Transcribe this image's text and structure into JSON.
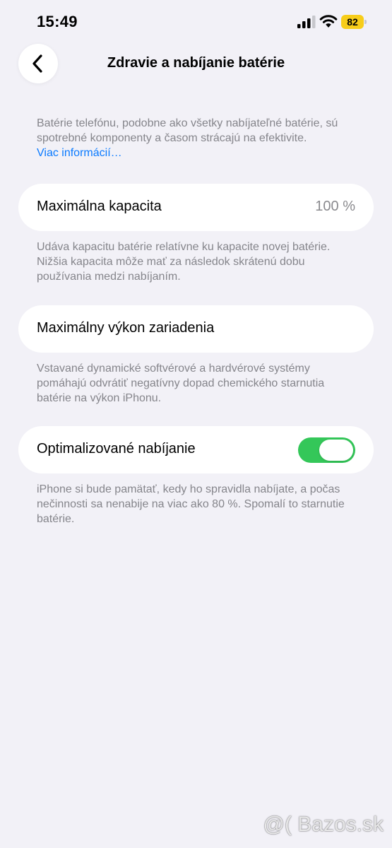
{
  "status_bar": {
    "time": "15:49",
    "battery_level": "82",
    "battery_color": "#f7cd1a",
    "icons": [
      "signal-icon",
      "wifi-icon",
      "battery-icon"
    ]
  },
  "nav": {
    "back_icon": "chevron-left-icon",
    "title": "Zdravie a nabíjanie batérie"
  },
  "intro": {
    "text": "Batérie telefónu, podobne ako všetky nabíjateľné batérie, sú spotrebné komponenty a časom strácajú na efektivite.",
    "link": "Viac informácií…",
    "link_color": "#0a7aff"
  },
  "max_capacity": {
    "label": "Maximálna kapacita",
    "value": "100 %",
    "footnote": "Udáva kapacitu batérie relatívne ku kapacite novej batérie. Nižšia kapacita môže mať za následok skrátenú dobu používania medzi nabíjaním."
  },
  "peak_performance": {
    "label": "Maximálny výkon zariadenia",
    "footnote": "Vstavané dynamické softvérové a hardvérové systémy pomáhajú odvrátiť negatívny dopad chemického starnutia batérie na výkon iPhonu."
  },
  "optimized_charging": {
    "label": "Optimalizované nabíjanie",
    "enabled": true,
    "toggle_color": "#34c759",
    "footnote": "iPhone si bude pamätať, kedy ho spravidla nabíjate, a počas nečinnosti sa nenabije na viac ako 80 %. Spomalí to starnutie batérie."
  },
  "watermark": "@( Bazos.sk"
}
